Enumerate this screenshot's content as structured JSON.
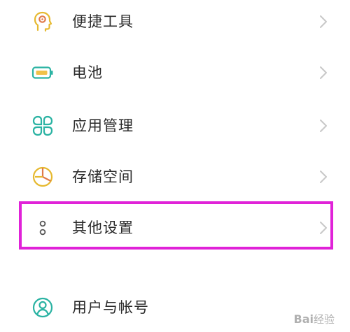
{
  "settings": {
    "items": [
      {
        "label": "便捷工具",
        "icon": "hand-icon"
      },
      {
        "label": "电池",
        "icon": "battery-icon"
      },
      {
        "label": "应用管理",
        "icon": "app-grid-icon"
      },
      {
        "label": "存储空间",
        "icon": "storage-pie-icon"
      },
      {
        "label": "其他设置",
        "icon": "more-dots-icon"
      },
      {
        "label": "用户与帐号",
        "icon": "user-icon"
      }
    ]
  },
  "colors": {
    "accent_teal": "#2bb3a3",
    "accent_yellow": "#e6b930",
    "highlight_magenta": "#e022d8",
    "text": "#2a2a2a",
    "chevron": "#c8c8c8"
  },
  "watermark": {
    "brand": "Bai",
    "sub": "经验"
  }
}
